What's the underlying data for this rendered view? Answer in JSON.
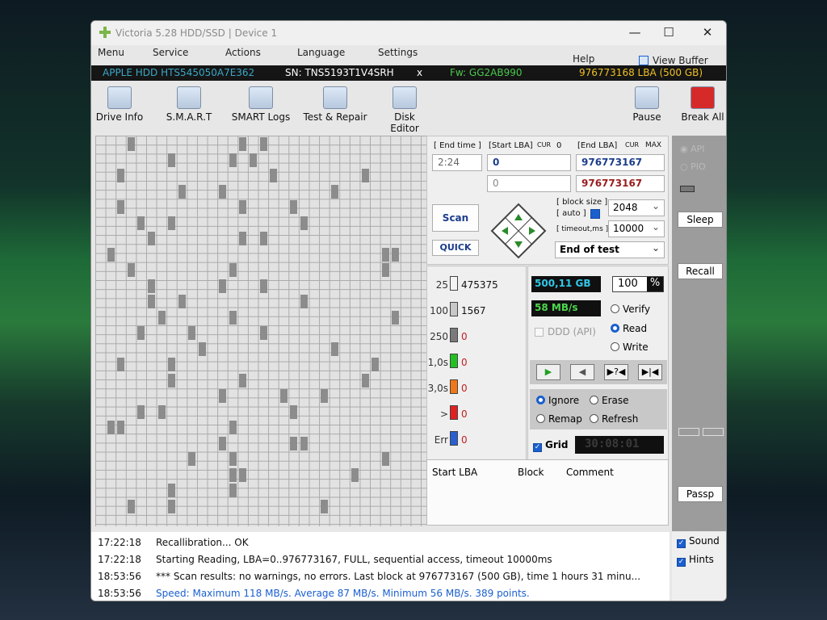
{
  "window": {
    "title": "Victoria 5.28 HDD/SSD | Device 1"
  },
  "menu": [
    "Menu",
    "Service",
    "Actions",
    "Language",
    "Settings",
    "Help",
    "View Buffer Live"
  ],
  "info": {
    "model": "APPLE HDD HTS545050A7E362",
    "sn": "SN: TNS5193T1V4SRH",
    "close": "x",
    "fw": "Fw: GG2AB990",
    "lba": "976773168 LBA (500 GB)"
  },
  "toolbar": [
    "Drive Info",
    "S.M.A.R.T",
    "SMART Logs",
    "Test & Repair",
    "Disk Editor",
    "Pause",
    "Break All"
  ],
  "scan": {
    "end_time_label": "[ End time ]",
    "start_lba_label": "[Start LBA]",
    "end_lba_label": "[End LBA]",
    "cur": "CUR",
    "max": "MAX",
    "zero": "0",
    "time": "2:24",
    "start_lba": "0",
    "end_lba": "976773167",
    "start_lba2": "0",
    "end_lba2": "976773167",
    "block_size_label": "[ block size ]",
    "auto_label": "[ auto ]",
    "timeout_label": "[ timeout,ms ]",
    "block_size": "2048",
    "timeout": "10000",
    "scan_button": "Scan",
    "quick_button": "QUICK",
    "end_mode": "End of test"
  },
  "counters": [
    {
      "label": "25",
      "count": "475375",
      "color": "#f4f4f4"
    },
    {
      "label": "100",
      "count": "1567",
      "color": "#c8c8c8"
    },
    {
      "label": "250",
      "count": "0",
      "color": "#7a7a7a"
    },
    {
      "label": "1,0s",
      "count": "0",
      "color": "#22c022"
    },
    {
      "label": "3,0s",
      "count": "0",
      "color": "#f07818"
    },
    {
      "label": ">",
      "count": "0",
      "color": "#e02020"
    },
    {
      "label": "Err",
      "count": "0",
      "color": "#2a5fd0"
    }
  ],
  "stats": {
    "size": "500,11 GB",
    "percent": "100",
    "percent_sign": "%",
    "speed": "58 MB/s",
    "ddd": "DDD (API)"
  },
  "modes": [
    "Verify",
    "Read",
    "Write"
  ],
  "actions": [
    "Ignore",
    "Erase",
    "Remap",
    "Refresh"
  ],
  "grid_label": "Grid",
  "timer": "30:08:01",
  "table": {
    "headers": [
      "Start LBA",
      "Block",
      "Comment"
    ]
  },
  "right_panel": {
    "api": "API",
    "pio": "PIO",
    "sleep": "Sleep",
    "recall": "Recall",
    "passp": "Passp",
    "sound": "Sound",
    "hints": "Hints"
  },
  "log": [
    {
      "time": "17:22:18",
      "text": "Recallibration... OK",
      "color": "#111111"
    },
    {
      "time": "17:22:18",
      "text": "Starting Reading, LBA=0..976773167, FULL, sequential access, timeout 10000ms",
      "color": "#111111"
    },
    {
      "time": "18:53:56",
      "text": "*** Scan results: no warnings, no errors. Last block at 976773167 (500 GB), time 1 hours 31 minu...",
      "color": "#111111"
    },
    {
      "time": "18:53:56",
      "text": "Speed: Maximum 118 MB/s. Average 87 MB/s. Minimum 56 MB/s. 389 points.",
      "color": "#1a5fd0"
    }
  ]
}
